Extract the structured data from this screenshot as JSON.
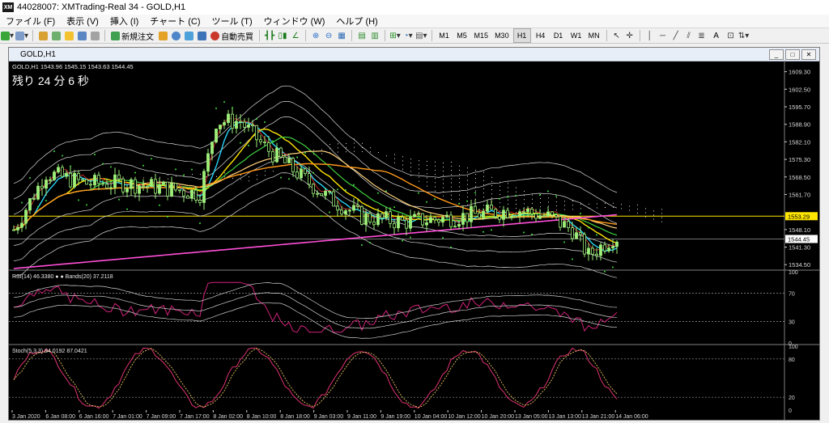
{
  "window": {
    "title": "44028007: XMTrading-Real 34 - GOLD,H1",
    "logo": "XM"
  },
  "menu": [
    "ファイル (F)",
    "表示 (V)",
    "挿入 (I)",
    "チャート (C)",
    "ツール (T)",
    "ウィンドウ (W)",
    "ヘルプ (H)"
  ],
  "toolbar": {
    "new_order": "新規注文",
    "auto_trade": "自動売買",
    "timeframes": [
      "M1",
      "M5",
      "M15",
      "M30",
      "H1",
      "H4",
      "D1",
      "W1",
      "MN"
    ],
    "active_timeframe": "H1",
    "text_tool": "A"
  },
  "chart": {
    "window_title": "GOLD,H1",
    "ohlc_header": "GOLD,H1  1543.96 1545.15 1543.63 1544.45",
    "countdown": "残り 24 分 6 秒",
    "price_axis": [
      "1609.30",
      "1602.50",
      "1595.70",
      "1588.90",
      "1582.10",
      "1575.30",
      "1568.50",
      "1561.70",
      "1548.10",
      "1541.30",
      "1534.50"
    ],
    "price_marker_yellow": "1553.29",
    "price_marker_current": "1544.45",
    "rsi_label": "RSI(14) 46.3380   ● ● Bands(20) 37.2118",
    "rsi_axis": [
      "100",
      "70",
      "30",
      "0"
    ],
    "stoch_label": "Stoch(5,3,3) 84.0192 87.0421",
    "stoch_axis": [
      "100",
      "80",
      "20",
      "0"
    ],
    "time_axis": [
      "3 Jan 2020",
      "6 Jan 08:00",
      "6 Jan 16:00",
      "7 Jan 01:00",
      "7 Jan 09:00",
      "7 Jan 17:00",
      "8 Jan 02:00",
      "8 Jan 10:00",
      "8 Jan 18:00",
      "9 Jan 03:00",
      "9 Jan 11:00",
      "9 Jan 19:00",
      "10 Jan 04:00",
      "10 Jan 12:00",
      "10 Jan 20:00",
      "13 Jan 05:00",
      "13 Jan 13:00",
      "13 Jan 21:00",
      "14 Jan 06:00"
    ],
    "colors": {
      "background": "#000000",
      "bull_candle": "#9ef07a",
      "yellow_line": "#ffe500",
      "cyan_line": "#29d3f5",
      "magenta_line": "#ff4fd8",
      "orange_line": "#ff9a1a",
      "green_line": "#3fd13f",
      "rsi_line": "#d1237a",
      "stoch_main": "#e0336f",
      "stoch_signal": "#e3c35b"
    }
  }
}
